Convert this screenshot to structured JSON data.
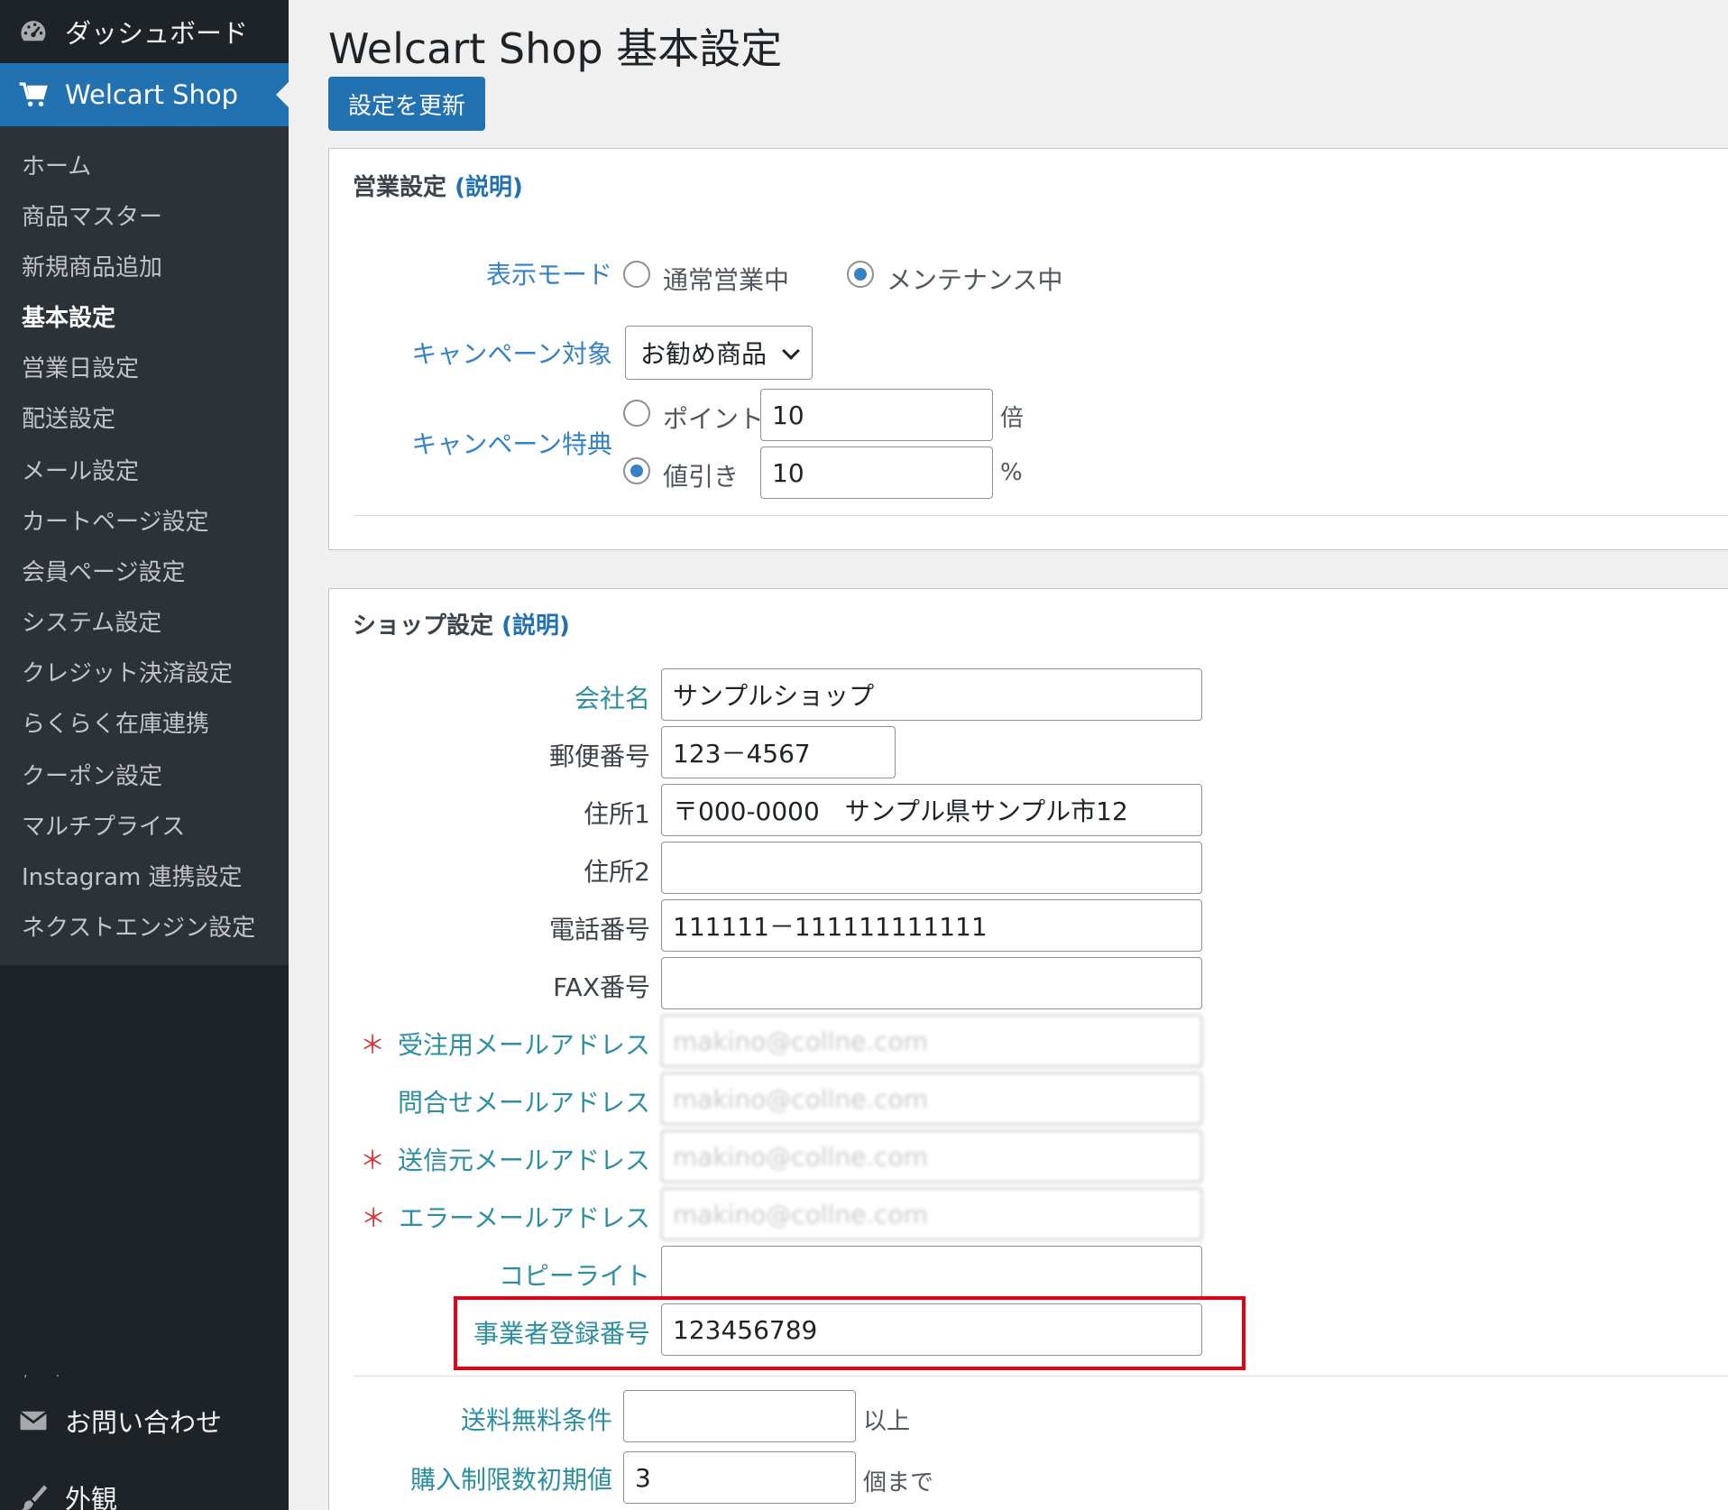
{
  "sidebar": {
    "dashboard": "ダッシュボード",
    "welcart": "Welcart Shop",
    "submenu": [
      "ホーム",
      "商品マスター",
      "新規商品追加",
      "基本設定",
      "営業日設定",
      "配送設定",
      "メール設定",
      "カートページ設定",
      "会員ページ設定",
      "システム設定",
      "クレジット決済設定",
      "らくらく在庫連携",
      "クーポン設定",
      "マルチプライス",
      "Instagram 連携設定",
      "ネクストエンジン設定"
    ],
    "current_index": 3,
    "contact": "お問い合わせ",
    "appearance": "外観"
  },
  "page": {
    "title": "Welcart Shop 基本設定",
    "update_button": "設定を更新"
  },
  "business": {
    "title": "営業設定",
    "help": "(説明)",
    "display_mode_label": "表示モード",
    "mode_normal": "通常営業中",
    "mode_maintenance": "メンテナンス中",
    "campaign_target_label": "キャンペーン対象",
    "campaign_target_value": "お勧め商品",
    "campaign_benefit_label": "キャンペーン特典",
    "point_label": "ポイント",
    "point_value": "10",
    "point_unit": "倍",
    "discount_label": "値引き",
    "discount_value": "10",
    "discount_unit": "%"
  },
  "shop": {
    "title": "ショップ設定",
    "help": "(説明)",
    "required_mark": "＊",
    "fields": {
      "company_label": "会社名",
      "company_value": "サンプルショップ",
      "zip_label": "郵便番号",
      "zip_value": "123－4567",
      "address1_label": "住所1",
      "address1_value": "〒000-0000　サンプル県サンプル市12",
      "address2_label": "住所2",
      "address2_value": "",
      "tel_label": "電話番号",
      "tel_value": "111111－111111111111",
      "fax_label": "FAX番号",
      "fax_value": "",
      "order_mail_label": "受注用メールアドレス",
      "order_mail_value": "makino@collne.com",
      "inquiry_mail_label": "問合せメールアドレス",
      "inquiry_mail_value": "makino@collne.com",
      "sender_mail_label": "送信元メールアドレス",
      "sender_mail_value": "makino@collne.com",
      "error_mail_label": "エラーメールアドレス",
      "error_mail_value": "makino@collne.com",
      "copyright_label": "コピーライト",
      "copyright_value": "",
      "registration_label": "事業者登録番号",
      "registration_value": "123456789"
    },
    "free_shipping_label": "送料無料条件",
    "free_shipping_value": "",
    "free_shipping_unit": "以上",
    "purchase_limit_label": "購入制限数初期値",
    "purchase_limit_value": "3",
    "purchase_limit_unit": "個まで"
  },
  "colors": {
    "sidebar_bg": "#1d2327",
    "submenu_bg": "#2c3338",
    "accent": "#2271b1",
    "label_blue": "#3582c4",
    "required_red": "#d63638",
    "highlight_red": "#e60012"
  }
}
